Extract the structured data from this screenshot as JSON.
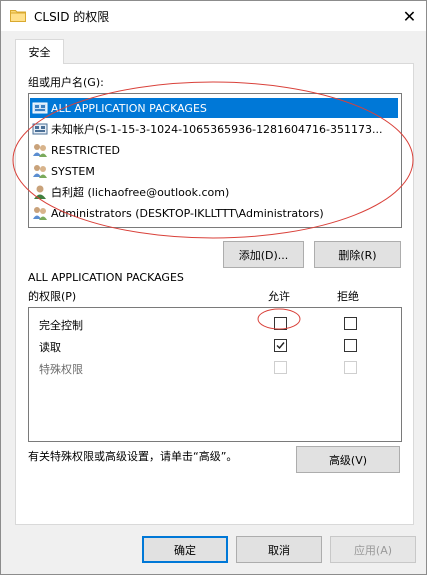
{
  "window": {
    "title": "CLSID 的权限",
    "close_symbol": "✕"
  },
  "tabs": [
    {
      "label": "安全"
    }
  ],
  "groups": {
    "label": "组或用户名(G):",
    "items": [
      {
        "name": "ALL APPLICATION PACKAGES",
        "icon": "app-packages-icon",
        "selected": true
      },
      {
        "name": "未知帐户(S-1-15-3-1024-1065365936-1281604716-351173...",
        "icon": "unknown-account-icon",
        "selected": false
      },
      {
        "name": "RESTRICTED",
        "icon": "group-users-icon",
        "selected": false
      },
      {
        "name": "SYSTEM",
        "icon": "group-users-icon",
        "selected": false
      },
      {
        "name": "白利超 (lichaofree@outlook.com)",
        "icon": "user-icon",
        "selected": false
      },
      {
        "name": "Administrators (DESKTOP-IKLLTTT\\Administrators)",
        "icon": "group-users-icon",
        "selected": false
      }
    ],
    "add_label": "添加(D)...",
    "remove_label": "删除(R)"
  },
  "permissions": {
    "for_label_line1": "ALL APPLICATION PACKAGES",
    "for_label_line2": "的权限(P)",
    "allow_header": "允许",
    "deny_header": "拒绝",
    "rows": [
      {
        "name": "完全控制",
        "allow": false,
        "deny": false,
        "disabled": false
      },
      {
        "name": "读取",
        "allow": true,
        "deny": false,
        "disabled": false
      },
      {
        "name": "特殊权限",
        "allow": false,
        "deny": false,
        "disabled": true
      }
    ]
  },
  "advanced": {
    "note": "有关特殊权限或高级设置，请单击“高级”。",
    "button": "高级(V)"
  },
  "footer": {
    "ok": "确定",
    "cancel": "取消",
    "apply": "应用(A)"
  },
  "colors": {
    "selection": "#0078d7",
    "annotation": "#d9413a",
    "dialog_bg": "#f0f0f0"
  }
}
